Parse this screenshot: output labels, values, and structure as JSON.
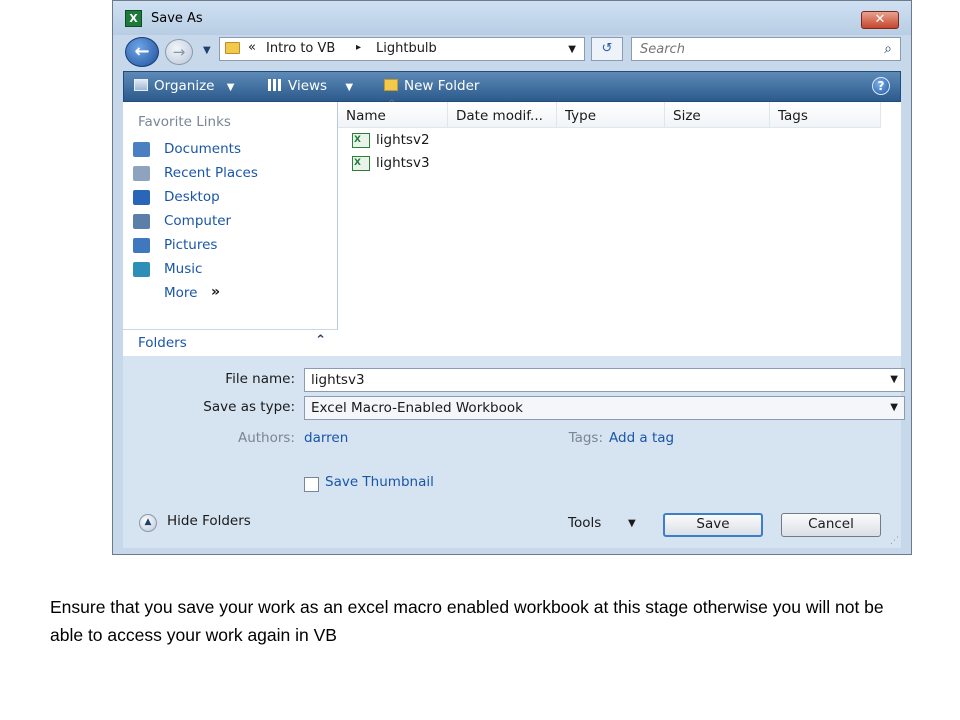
{
  "window": {
    "title": "Save As",
    "close_glyph": "✕",
    "app_icon": "excel-icon"
  },
  "address": {
    "chevron": "«",
    "crumbs": [
      "Intro to VB",
      "Lightbulb"
    ],
    "separator": "▸",
    "dropdown_glyph": "▼",
    "refresh_glyph": "↺",
    "search_placeholder": "Search",
    "search_glyph": "⌕"
  },
  "toolbar": {
    "organize": "Organize",
    "views": "Views",
    "new_folder": "New Folder",
    "dropdown_glyph": "▼",
    "help": "?"
  },
  "sidebar": {
    "header": "Favorite Links",
    "items": [
      {
        "label": "Documents",
        "icon": "documents-icon",
        "color": "#4a7fc1"
      },
      {
        "label": "Recent Places",
        "icon": "recent-places-icon",
        "color": "#8ea3bd"
      },
      {
        "label": "Desktop",
        "icon": "desktop-icon",
        "color": "#2a66b8"
      },
      {
        "label": "Computer",
        "icon": "computer-icon",
        "color": "#5b7fa8"
      },
      {
        "label": "Pictures",
        "icon": "pictures-icon",
        "color": "#3f78bf"
      },
      {
        "label": "Music",
        "icon": "music-icon",
        "color": "#2d8fb8"
      }
    ],
    "more": "More",
    "more_glyph": "»",
    "folders": "Folders",
    "folders_glyph": "⌃"
  },
  "file_list": {
    "columns": [
      "Name",
      "Date modif...",
      "Type",
      "Size",
      "Tags"
    ],
    "sort_glyph": "^",
    "files": [
      "lightsv2",
      "lightsv3"
    ]
  },
  "form": {
    "file_name_label": "File name:",
    "file_name_value": "lightsv3",
    "save_type_label": "Save as type:",
    "save_type_value": "Excel Macro-Enabled Workbook",
    "authors_label": "Authors:",
    "authors_value": "darren",
    "tags_label": "Tags:",
    "tags_value": "Add a tag",
    "thumbnail_label": "Save Thumbnail",
    "dropdown_glyph": "▼"
  },
  "footer": {
    "hide_folders": "Hide Folders",
    "hide_glyph": "▲",
    "tools": "Tools",
    "tools_glyph": "▼",
    "save": "Save",
    "cancel": "Cancel",
    "grip_glyph": "⋰"
  },
  "caption": "Ensure that you save your work as an excel macro enabled workbook at this stage otherwise you will not be able to access your work again in VB"
}
